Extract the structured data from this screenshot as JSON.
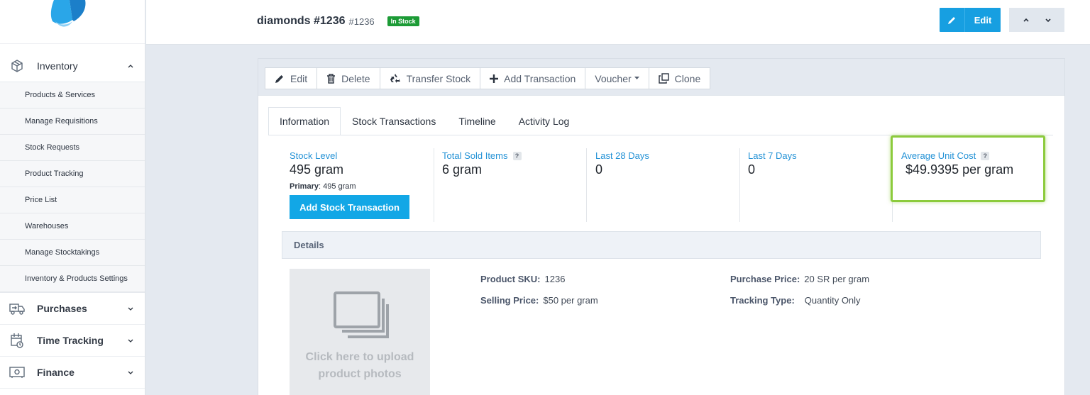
{
  "sidebar": {
    "inventory": {
      "label": "Inventory",
      "items": [
        "Products & Services",
        "Manage Requisitions",
        "Stock Requests",
        "Product Tracking",
        "Price List",
        "Warehouses",
        "Manage Stocktakings",
        "Inventory & Products Settings"
      ]
    },
    "purchases": "Purchases",
    "time_tracking": "Time Tracking",
    "finance": "Finance"
  },
  "header": {
    "product_name": "diamonds #1236",
    "product_code": "#1236",
    "status_badge": "In Stock",
    "edit_label": "Edit"
  },
  "toolbar": {
    "edit": "Edit",
    "delete": "Delete",
    "transfer": "Transfer Stock",
    "add_transaction": "Add Transaction",
    "voucher": "Voucher",
    "clone": "Clone"
  },
  "tabs": [
    "Information",
    "Stock Transactions",
    "Timeline",
    "Activity Log"
  ],
  "stats": {
    "stock_level": {
      "label": "Stock Level",
      "value": "495 gram",
      "primary_key": "Primary",
      "primary_value": ": 495 gram"
    },
    "add_stock_button": "Add Stock Transaction",
    "total_sold": {
      "label": "Total Sold Items",
      "value": "6 gram"
    },
    "last_28": {
      "label": "Last 28 Days",
      "value": "0"
    },
    "last_7": {
      "label": "Last 7 Days",
      "value": "0"
    },
    "avg_cost": {
      "label": "Average Unit Cost",
      "value": "$49.9395",
      "unit": " per gram"
    },
    "help_glyph": "?"
  },
  "details": {
    "heading": "Details",
    "upload_text_1": "Click here to upload",
    "upload_text_2": "product photos",
    "sku_label": "Product SKU:",
    "sku_value": "1236",
    "selling_label": "Selling Price:",
    "selling_value": "$50 per gram",
    "purchase_label": "Purchase Price:",
    "purchase_value": "20 SR per gram",
    "tracking_label": "Tracking Type:",
    "tracking_value": "Quantity Only"
  },
  "colors": {
    "accent": "#179fe1",
    "link": "#2392d6",
    "success": "#1c9b36",
    "highlight": "#8ccb3c"
  }
}
